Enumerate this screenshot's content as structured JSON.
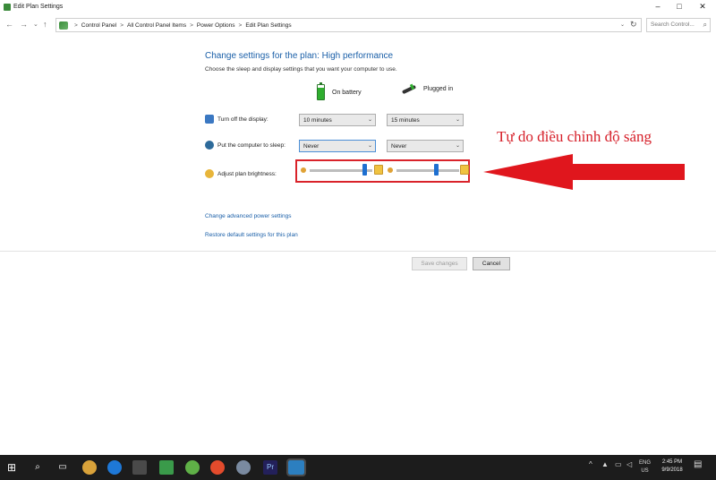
{
  "window": {
    "title": "Edit Plan Settings",
    "controls": {
      "minimize": "–",
      "maximize": "□",
      "close": "✕"
    }
  },
  "address": {
    "nav_back": "←",
    "nav_forward": "→",
    "nav_down": "⌄",
    "nav_up": "↑",
    "crumbs": [
      "Control Panel",
      "All Control Panel Items",
      "Power Options",
      "Edit Plan Settings"
    ],
    "separator": ">",
    "dropdown": "⌄",
    "refresh": "↻",
    "search_placeholder": "Search Control..."
  },
  "plan": {
    "heading": "Change settings for the plan: High performance",
    "subheading": "Choose the sleep and display settings that you want your computer to use.",
    "col_battery": "On battery",
    "col_plugged": "Plugged in",
    "rows": [
      {
        "label": "Turn off the display:",
        "battery": "10 minutes",
        "plugged": "15 minutes"
      },
      {
        "label": "Put the computer to sleep:",
        "battery": "Never",
        "plugged": "Never"
      },
      {
        "label": "Adjust plan brightness:"
      }
    ],
    "brightness": {
      "battery_level": 0.9,
      "plugged_level": 0.65
    },
    "link_advanced": "Change advanced power settings",
    "link_restore": "Restore default settings for this plan"
  },
  "buttons": {
    "save": "Save changes",
    "cancel": "Cancel"
  },
  "annotation": {
    "text": "Tự do điều chỉnh độ sáng",
    "color": "#d6202a"
  },
  "taskbar": {
    "start": "⊞",
    "search": "⌕",
    "taskview": "▭",
    "tray_lang_1": "ENG",
    "tray_lang_2": "US",
    "time": "2:45 PM",
    "date": "9/9/2018",
    "tray_up": "^"
  },
  "colors": {
    "accent": "#1a5fa8",
    "highlight": "#d9232a",
    "taskbar": "#1c1c1c"
  }
}
